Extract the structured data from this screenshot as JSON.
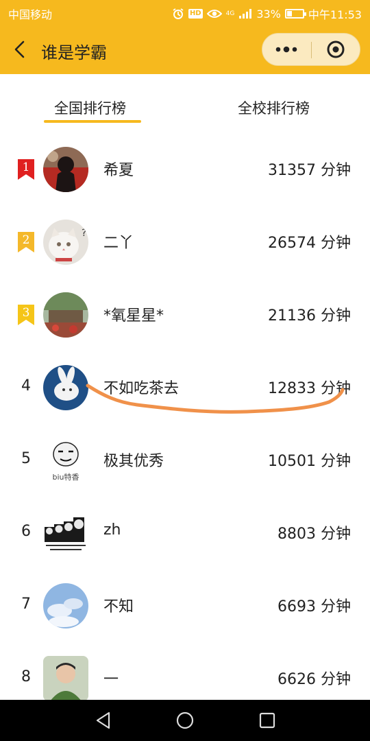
{
  "status": {
    "carrier": "中国移动",
    "signal_label": "4G",
    "battery": "33%",
    "time": "中午11:53",
    "hd": "HD",
    "battery_level": 0.33
  },
  "header": {
    "title": "谁是学霸"
  },
  "tabs": [
    {
      "label": "全国排行榜",
      "active": true
    },
    {
      "label": "全校排行榜",
      "active": false
    }
  ],
  "ranking": [
    {
      "rank": "1",
      "name": "希夏",
      "score": "31357 分钟",
      "badge": "1",
      "badge_color": "#e02020",
      "avatar_color": "#6b3b2a"
    },
    {
      "rank": "2",
      "name": "二丫",
      "score": "26574 分钟",
      "badge": "2",
      "badge_color": "#f4b82a",
      "avatar_color": "#d9d4cc"
    },
    {
      "rank": "3",
      "name": "*氧星星*",
      "score": "21136 分钟",
      "badge": "3",
      "badge_color": "#f5c518",
      "avatar_color": "#7a6a4a"
    },
    {
      "rank": "4",
      "name": "不如吃茶去",
      "score": "12833 分钟",
      "avatar_color": "#1f4f86"
    },
    {
      "rank": "5",
      "name": "极其优秀",
      "score": "10501 分钟",
      "avatar_color": "#ffffff",
      "avatar_caption": "biu特香"
    },
    {
      "rank": "6",
      "name": "zh",
      "score": "8803 分钟",
      "avatar_color": "#ffffff"
    },
    {
      "rank": "7",
      "name": "不知",
      "score": "6693 分钟",
      "avatar_color": "#8fb6e2"
    },
    {
      "rank": "8",
      "name": "一",
      "score": "6626 分钟",
      "avatar_color": "#b7c6a8"
    }
  ],
  "colors": {
    "accent": "#f6b91e",
    "scribble": "#f0914a"
  }
}
